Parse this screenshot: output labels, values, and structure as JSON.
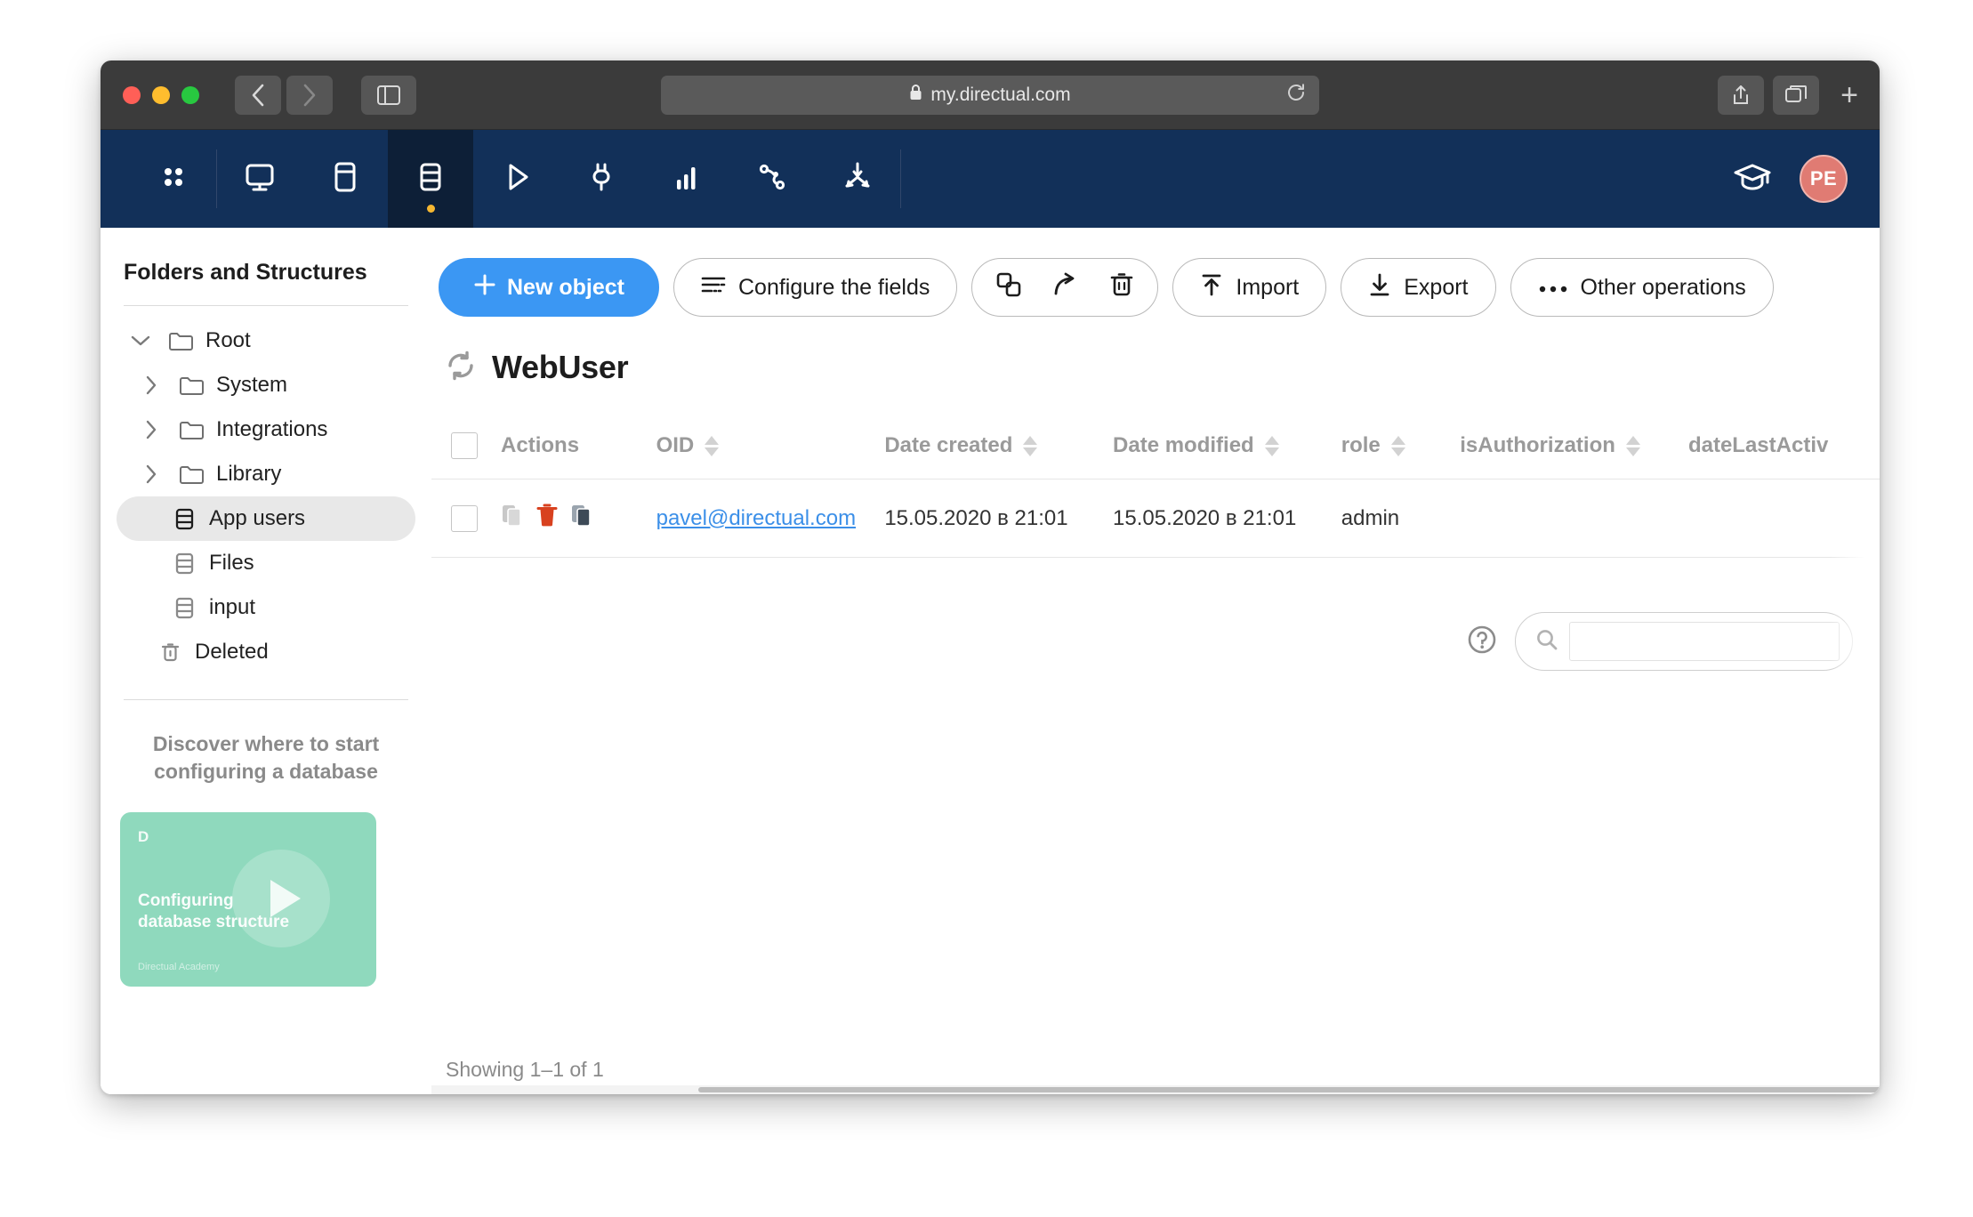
{
  "browser": {
    "url": "my.directual.com",
    "lock_icon": "lock-icon",
    "back_icon": "chevron-left-icon",
    "forward_icon": "chevron-right-icon",
    "sidebar_icon": "sidebar-toggle-icon",
    "reload_icon": "reload-icon",
    "share_icon": "share-icon",
    "tabs_icon": "tab-overview-icon",
    "new_tab_label": "+"
  },
  "appnav": {
    "items": [
      {
        "name": "apps-grid-icon",
        "active": false
      },
      {
        "name": "monitor-icon",
        "active": false
      },
      {
        "name": "card-panel-icon",
        "active": false
      },
      {
        "name": "database-icon",
        "active": true
      },
      {
        "name": "play-icon",
        "active": false
      },
      {
        "name": "plug-icon",
        "active": false
      },
      {
        "name": "bar-chart-icon",
        "active": false
      },
      {
        "name": "branch-network-icon",
        "active": false
      },
      {
        "name": "converge-arrows-icon",
        "active": false
      }
    ],
    "academy_icon": "graduation-cap-icon",
    "avatar_initials": "PE",
    "avatar_color": "#e07b73",
    "background": "#123059"
  },
  "sidebar": {
    "title": "Folders and Structures",
    "tree": [
      {
        "label": "Root",
        "icon": "folder-icon",
        "chevron": "chevron-down-icon",
        "level": 0,
        "selected": false
      },
      {
        "label": "System",
        "icon": "folder-icon",
        "chevron": "chevron-right-icon",
        "level": 1,
        "selected": false
      },
      {
        "label": "Integrations",
        "icon": "folder-icon",
        "chevron": "chevron-right-icon",
        "level": 1,
        "selected": false
      },
      {
        "label": "Library",
        "icon": "folder-icon",
        "chevron": "chevron-right-icon",
        "level": 1,
        "selected": false
      },
      {
        "label": "App users",
        "icon": "structure-icon",
        "chevron": "",
        "level": 2,
        "selected": true
      },
      {
        "label": "Files",
        "icon": "structure-icon",
        "chevron": "",
        "level": 2,
        "selected": false
      },
      {
        "label": "input",
        "icon": "structure-icon",
        "chevron": "",
        "level": 2,
        "selected": false
      },
      {
        "label": "Deleted",
        "icon": "trash-icon",
        "chevron": "",
        "level": 1,
        "selected": false
      }
    ],
    "promo": {
      "heading_line1": "Discover where to start",
      "heading_line2": "configuring a database",
      "card_logo": "D",
      "card_title_line1": "Configuring",
      "card_title_line2": "database structure",
      "card_footer": "Directual Academy",
      "card_color": "#8fd9bd",
      "play_icon": "play-icon"
    }
  },
  "toolbar": {
    "new_object": "New object",
    "new_object_icon": "plus-icon",
    "configure_fields": "Configure the fields",
    "configure_fields_icon": "sliders-icon",
    "group_icons": [
      "copy-icon",
      "move-arrow-icon",
      "trash-icon"
    ],
    "import": "Import",
    "import_icon": "arrow-up-bar-icon",
    "export": "Export",
    "export_icon": "arrow-down-bar-icon",
    "other_operations": "Other operations",
    "other_operations_icon": "ellipsis-icon",
    "primary_color": "#3b97f3"
  },
  "table_header": {
    "title": "WebUser",
    "refresh_icon": "refresh-icon",
    "help_icon": "help-circle-icon",
    "search_icon": "search-icon",
    "search_value": "",
    "search_placeholder": ""
  },
  "table": {
    "columns": [
      {
        "label": "",
        "name": "select-all",
        "sortable": false
      },
      {
        "label": "Actions",
        "name": "actions",
        "sortable": false
      },
      {
        "label": "OID",
        "name": "oid",
        "sortable": true
      },
      {
        "label": "Date created",
        "name": "date-created",
        "sortable": true
      },
      {
        "label": "Date modified",
        "name": "date-modified",
        "sortable": true
      },
      {
        "label": "role",
        "name": "role",
        "sortable": true
      },
      {
        "label": "isAuthorization",
        "name": "isauthorization",
        "sortable": true
      },
      {
        "label": "dateLastActiv",
        "name": "datelastactivity",
        "sortable": false
      }
    ],
    "rows": [
      {
        "oid": "pavel@directual.com",
        "date_created": "15.05.2020 в 21:01",
        "date_modified": "15.05.2020 в 21:01",
        "role": "admin",
        "is_authorization": "",
        "date_last_activity": "",
        "action_icons": [
          "copy-icon",
          "delete-icon",
          "duplicate-icon"
        ],
        "link_color": "#3b8fe8",
        "delete_color": "#d8411f"
      }
    ],
    "footer": "Showing 1–1 of 1"
  }
}
